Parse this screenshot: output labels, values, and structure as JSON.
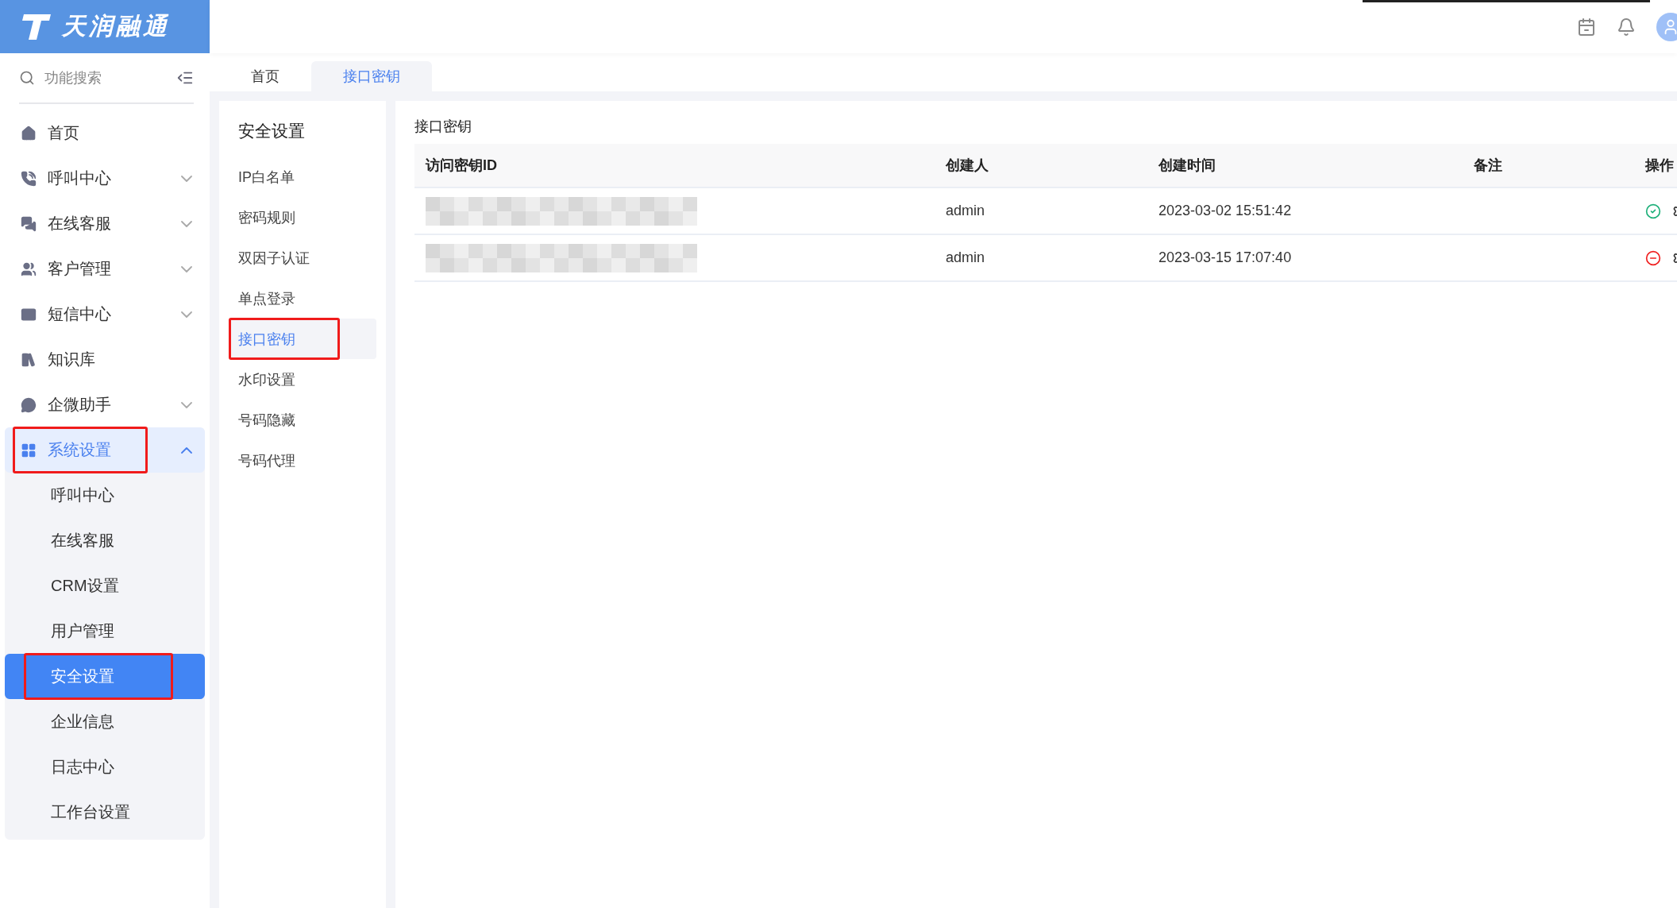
{
  "brand": {
    "name": "天润融通"
  },
  "search": {
    "placeholder": "功能搜索"
  },
  "nav": [
    {
      "label": "首页",
      "selected": false
    },
    {
      "label": "呼叫中心",
      "selected": false,
      "expanded": false
    },
    {
      "label": "在线客服",
      "selected": false,
      "expanded": false
    },
    {
      "label": "客户管理",
      "selected": false,
      "expanded": false
    },
    {
      "label": "短信中心",
      "selected": false,
      "expanded": false
    },
    {
      "label": "知识库",
      "selected": false
    },
    {
      "label": "企微助手",
      "selected": false,
      "expanded": false
    },
    {
      "label": "系统设置",
      "selected": true,
      "expanded": true,
      "annotated": true,
      "children": [
        {
          "label": "呼叫中心",
          "selected": false
        },
        {
          "label": "在线客服",
          "selected": false
        },
        {
          "label": "CRM设置",
          "selected": false
        },
        {
          "label": "用户管理",
          "selected": false
        },
        {
          "label": "安全设置",
          "selected": true,
          "annotated": true
        },
        {
          "label": "企业信息",
          "selected": false
        },
        {
          "label": "日志中心",
          "selected": false
        },
        {
          "label": "工作台设置",
          "selected": false
        }
      ]
    }
  ],
  "tabs": [
    {
      "label": "首页",
      "selected": false
    },
    {
      "label": "接口密钥",
      "selected": true
    }
  ],
  "submenu": {
    "title": "安全设置",
    "items": [
      {
        "label": "IP白名单",
        "selected": false
      },
      {
        "label": "密码规则",
        "selected": false
      },
      {
        "label": "双因子认证",
        "selected": false
      },
      {
        "label": "单点登录",
        "selected": false
      },
      {
        "label": "接口密钥",
        "selected": true,
        "annotated": true
      },
      {
        "label": "水印设置",
        "selected": false
      },
      {
        "label": "号码隐藏",
        "selected": false
      },
      {
        "label": "号码代理",
        "selected": false
      }
    ]
  },
  "table": {
    "title": "接口密钥",
    "columns": [
      "访问密钥ID",
      "创建人",
      "创建时间",
      "备注",
      "操作"
    ],
    "rows": [
      {
        "key_redacted": true,
        "creator": "admin",
        "created": "2023-03-02 15:51:42",
        "enabled": true
      },
      {
        "key_redacted": true,
        "creator": "admin",
        "created": "2023-03-15 17:07:40",
        "enabled": false
      }
    ]
  }
}
